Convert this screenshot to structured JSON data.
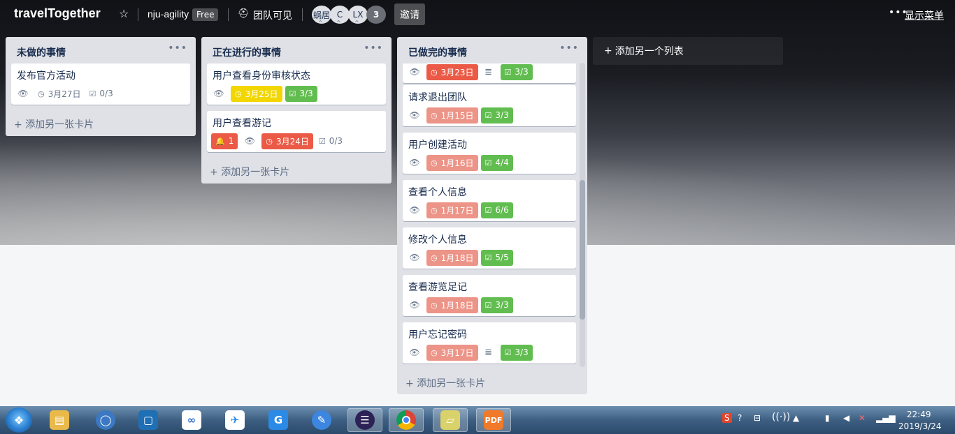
{
  "header": {
    "board_title": "travelTogether",
    "team_name": "nju-agility",
    "plan_badge": "Free",
    "visibility": "团队可见",
    "members": [
      "蜗居",
      "C",
      "LX"
    ],
    "member_count": "3",
    "invite_label": "邀请",
    "menu_label": "显示菜单"
  },
  "lists": [
    {
      "title": "未做的事情",
      "add_card": "添加另一张卡片",
      "cards": [
        {
          "title": "发布官方活动",
          "due": "3月27日",
          "checklist": "0/3"
        }
      ]
    },
    {
      "title": "正在进行的事情",
      "add_card": "添加另一张卡片",
      "cards": [
        {
          "title": "用户查看身份审核状态",
          "due": "3月25日",
          "checklist": "3/3"
        },
        {
          "title": "用户查看游记",
          "notifications": "1",
          "due": "3月24日",
          "checklist": "0/3"
        }
      ]
    },
    {
      "title": "已做完的事情",
      "add_card": "添加另一张卡片",
      "cards": [
        {
          "title": "",
          "due": "3月23日",
          "checklist": "3/3"
        },
        {
          "title": "请求退出团队",
          "due": "1月15日",
          "checklist": "3/3"
        },
        {
          "title": "用户创建活动",
          "due": "1月16日",
          "checklist": "4/4"
        },
        {
          "title": "查看个人信息",
          "due": "1月17日",
          "checklist": "6/6"
        },
        {
          "title": "修改个人信息",
          "due": "1月18日",
          "checklist": "5/5"
        },
        {
          "title": "查看游览足记",
          "due": "1月18日",
          "checklist": "3/3"
        },
        {
          "title": "用户忘记密码",
          "due": "3月17日",
          "checklist": "3/3"
        }
      ]
    }
  ],
  "add_list_label": "添加另一个列表",
  "taskbar": {
    "time": "22:49",
    "date": "2019/3/24"
  },
  "colors": {
    "due_overdue": "#eb5a46",
    "due_past": "#ec9488",
    "due_soon": "#f2d600",
    "checklist_done": "#61bd4f"
  }
}
